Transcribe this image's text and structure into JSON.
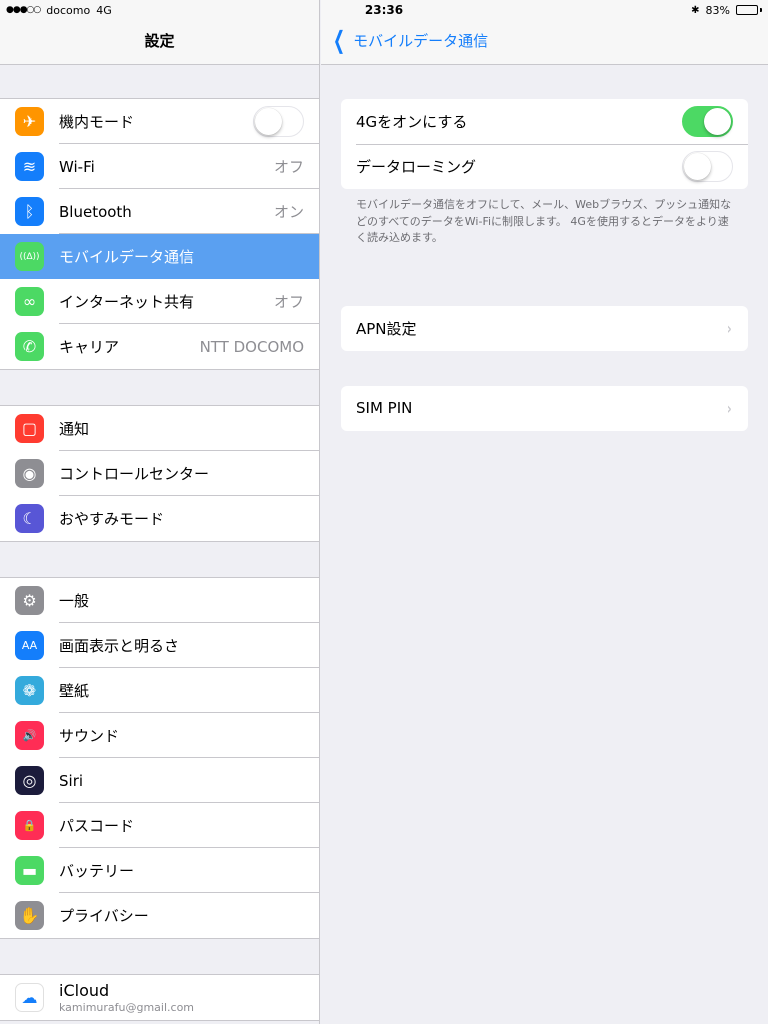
{
  "status": {
    "signal": "●●●○○",
    "carrier": "docomo",
    "network": "4G",
    "time": "23:36",
    "bluetooth": "✱",
    "battery": "83%",
    "battery_level": 0.83
  },
  "master": {
    "title": "設定",
    "groups": [
      [
        {
          "icon": "airplane-icon",
          "glyph": "✈",
          "color": "#ff9500",
          "label": "機内モード",
          "toggle": false
        },
        {
          "icon": "wifi-icon",
          "glyph": "≋",
          "color": "#147efb",
          "label": "Wi-Fi",
          "value": "オフ"
        },
        {
          "icon": "bluetooth-icon",
          "glyph": "ᛒ",
          "color": "#147efb",
          "label": "Bluetooth",
          "value": "オン"
        },
        {
          "icon": "cellular-antenna-icon",
          "glyph": "((∆))",
          "color": "#4cd964",
          "label": "モバイルデータ通信",
          "selected": true
        },
        {
          "icon": "hotspot-icon",
          "glyph": "∞",
          "color": "#4cd964",
          "label": "インターネット共有",
          "value": "オフ"
        },
        {
          "icon": "phone-icon",
          "glyph": "✆",
          "color": "#4cd964",
          "label": "キャリア",
          "value": "NTT DOCOMO"
        }
      ],
      [
        {
          "icon": "notifications-icon",
          "glyph": "▢",
          "color": "#ff3b30",
          "label": "通知"
        },
        {
          "icon": "control-center-icon",
          "glyph": "◉",
          "color": "#8e8e93",
          "label": "コントロールセンター"
        },
        {
          "icon": "moon-icon",
          "glyph": "☾",
          "color": "#5856d6",
          "label": "おやすみモード"
        }
      ],
      [
        {
          "icon": "gear-icon",
          "glyph": "⚙",
          "color": "#8e8e93",
          "label": "一般"
        },
        {
          "icon": "display-brightness-icon",
          "glyph": "AA",
          "color": "#147efb",
          "label": "画面表示と明るさ"
        },
        {
          "icon": "wallpaper-icon",
          "glyph": "❁",
          "color": "#34aadc",
          "label": "壁紙"
        },
        {
          "icon": "speaker-icon",
          "glyph": "🔊",
          "color": "#ff2d55",
          "label": "サウンド"
        },
        {
          "icon": "siri-icon",
          "glyph": "◎",
          "color": "#1c1c3c",
          "label": "Siri"
        },
        {
          "icon": "lock-icon",
          "glyph": "🔒",
          "color": "#ff2d55",
          "label": "パスコード"
        },
        {
          "icon": "battery-icon",
          "glyph": "▬",
          "color": "#4cd964",
          "label": "バッテリー"
        },
        {
          "icon": "hand-icon",
          "glyph": "✋",
          "color": "#8e8e93",
          "label": "プライバシー"
        }
      ],
      [
        {
          "icon": "icloud-icon",
          "glyph": "☁",
          "color": "#ffffff",
          "glyph_color": "#147efb",
          "label": "iCloud",
          "sublabel": "kamimurafu@gmail.com"
        }
      ]
    ]
  },
  "detail": {
    "back_label": "モバイルデータ通信",
    "lte_label": "4Gをオンにする",
    "lte_on": true,
    "roaming_label": "データローミング",
    "roaming_on": false,
    "footnote": "モバイルデータ通信をオフにして、メール、Webブラウズ、プッシュ通知などのすべてのデータをWi-Fiに制限します。 4Gを使用するとデータをより速く読み込めます。",
    "apn_label": "APN設定",
    "simpin_label": "SIM PIN",
    "chevron": "›"
  }
}
